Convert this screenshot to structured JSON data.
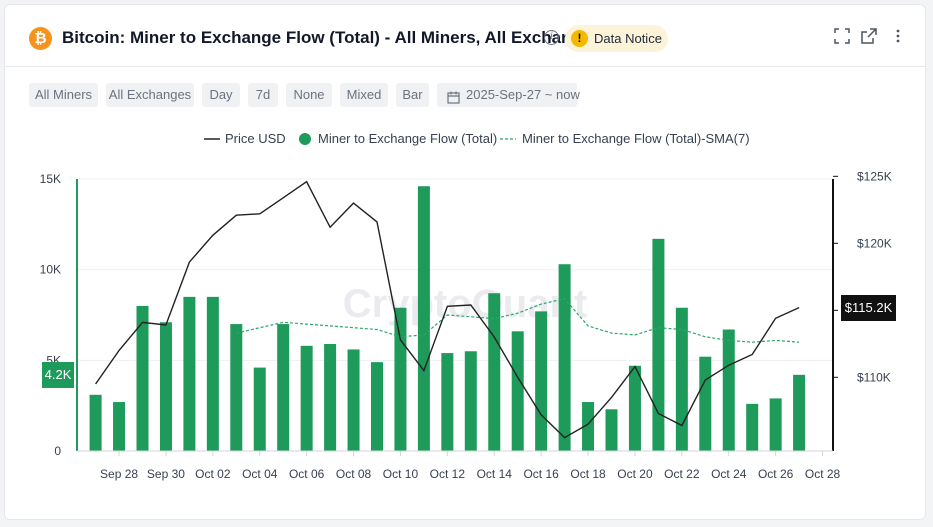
{
  "header": {
    "coin_symbol": "₿",
    "title": "Bitcoin: Miner to Exchange Flow (Total) - All Miners, All Exchanges",
    "info_icon": "info-icon",
    "notice_label": "Data Notice",
    "icons": [
      "fullscreen-icon",
      "external-link-icon",
      "more-vertical-icon"
    ]
  },
  "toolbar": {
    "chips": [
      "All Miners",
      "All Exchanges",
      "Day",
      "7d",
      "None",
      "Mixed",
      "Bar"
    ],
    "date_range": "2025-Sep-27 ~ now"
  },
  "legend": {
    "price": "Price USD",
    "flow": "Miner to Exchange Flow (Total)",
    "sma": "Miner to Exchange Flow (Total)-SMA(7)"
  },
  "colors": {
    "bar": "#1e9a5a",
    "price": "#222222",
    "sma": "#2aa86a",
    "notice": "#f5b800",
    "bitcoin": "#f7931a"
  },
  "watermark": "CryptoQuant",
  "chart_data": {
    "type": "bar",
    "title": "Bitcoin: Miner to Exchange Flow (Total) - All Miners, All Exchanges",
    "x_tick_labels": [
      "Sep 28",
      "Sep 30",
      "Oct 02",
      "Oct 04",
      "Oct 06",
      "Oct 08",
      "Oct 10",
      "Oct 12",
      "Oct 14",
      "Oct 16",
      "Oct 18",
      "Oct 20",
      "Oct 22",
      "Oct 24",
      "Oct 26",
      "Oct 28"
    ],
    "y_left": {
      "ticks": [
        "0",
        "5K",
        "10K",
        "15K"
      ],
      "ylim": [
        0,
        15000
      ]
    },
    "y_right": {
      "ticks": [
        "$110K",
        "$115K",
        "$120K",
        "$125K"
      ],
      "ylim": [
        104500,
        124800
      ]
    },
    "current_left_label": "4.2K",
    "current_left_value": 4200,
    "current_right_label": "$115.2K",
    "current_right_value": 115200,
    "dates": [
      "Sep 27",
      "Sep 28",
      "Sep 29",
      "Sep 30",
      "Oct 01",
      "Oct 02",
      "Oct 03",
      "Oct 04",
      "Oct 05",
      "Oct 06",
      "Oct 07",
      "Oct 08",
      "Oct 09",
      "Oct 10",
      "Oct 11",
      "Oct 12",
      "Oct 13",
      "Oct 14",
      "Oct 15",
      "Oct 16",
      "Oct 17",
      "Oct 18",
      "Oct 19",
      "Oct 20",
      "Oct 21",
      "Oct 22",
      "Oct 23",
      "Oct 24",
      "Oct 25",
      "Oct 26",
      "Oct 27"
    ],
    "series": [
      {
        "name": "Miner to Exchange Flow (Total)",
        "type": "bar",
        "axis": "left",
        "values": [
          3100,
          2700,
          8000,
          7100,
          8500,
          8500,
          7000,
          4600,
          7000,
          5800,
          5900,
          5600,
          4900,
          7900,
          14600,
          5400,
          5500,
          8700,
          6600,
          7700,
          10300,
          2700,
          2300,
          4700,
          11700,
          7900,
          5200,
          6700,
          2600,
          2900,
          4200
        ]
      },
      {
        "name": "Price USD",
        "type": "line",
        "axis": "right",
        "values": [
          109500,
          112000,
          114100,
          113900,
          118600,
          120600,
          122100,
          122200,
          123400,
          124600,
          121200,
          123000,
          121600,
          112800,
          110500,
          115300,
          115400,
          113000,
          110000,
          107200,
          105500,
          106500,
          108500,
          110800,
          107300,
          106400,
          109800,
          110900,
          111700,
          114400,
          115200
        ]
      },
      {
        "name": "Miner to Exchange Flow (Total)-SMA(7)",
        "type": "line",
        "axis": "left",
        "style": "dashed",
        "values": [
          null,
          null,
          null,
          null,
          null,
          null,
          6500,
          6800,
          7100,
          7000,
          6900,
          6800,
          6700,
          6300,
          6400,
          7500,
          7400,
          7300,
          7600,
          8100,
          8400,
          6900,
          6500,
          6400,
          6800,
          6700,
          6300,
          6100,
          6000,
          6100,
          6000
        ]
      }
    ]
  }
}
